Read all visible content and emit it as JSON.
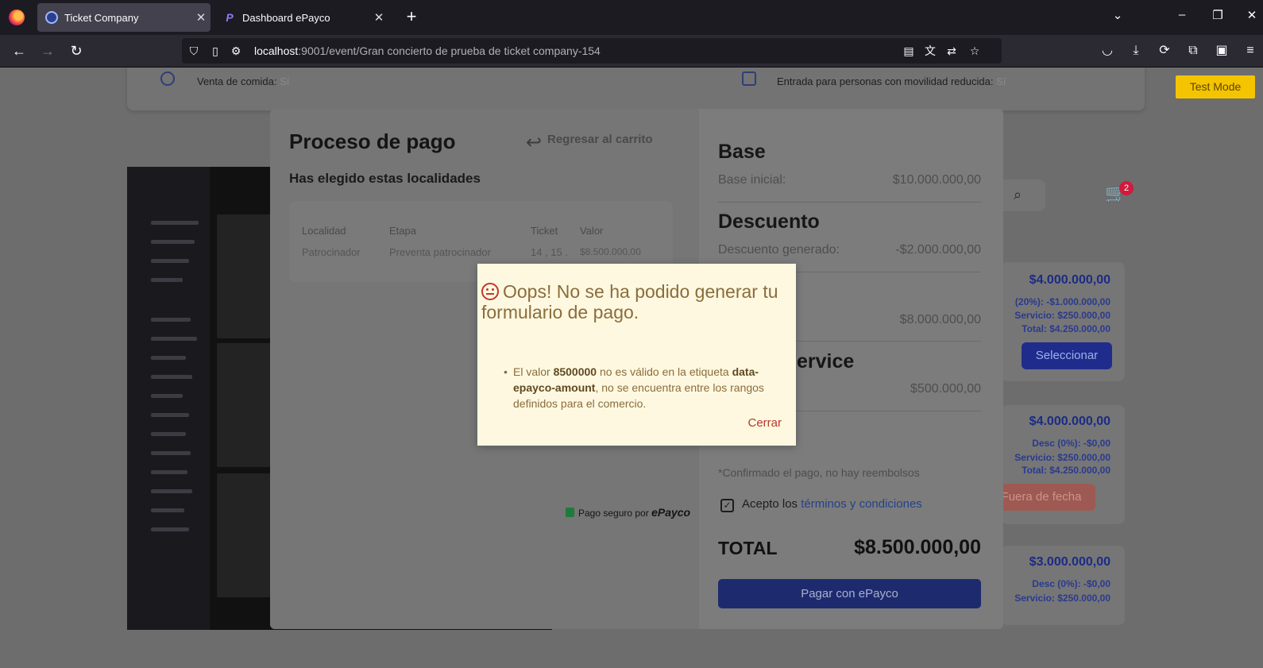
{
  "browser": {
    "tabs": [
      {
        "title": "Ticket Company",
        "active": true
      },
      {
        "title": "Dashboard ePayco",
        "active": false
      }
    ],
    "url_host": "localhost",
    "url_rest": ":9001/event/Gran concierto de prueba de ticket company-154"
  },
  "event_info": {
    "food_label": "Venta de comida:",
    "food_value": "Sí",
    "access_label": "Entrada para personas con movilidad reducida:",
    "access_value": "Sí"
  },
  "test_mode": "Test Mode",
  "cart_count": "2",
  "ticket_options": [
    {
      "price": "$4.000.000,00",
      "discount": "(20%): -$1.000.000,00",
      "service": "Servicio: $250.000,00",
      "total": "Total: $4.250.000,00",
      "button": "Seleccionar",
      "button_color": "#1f2c8c"
    },
    {
      "price": "$4.000.000,00",
      "discount": "Desc (0%): -$0,00",
      "service": "Servicio: $250.000,00",
      "total": "Total: $4.250.000,00",
      "button": "Fuera de fecha",
      "button_color": "#9e5a52"
    },
    {
      "price": "$3.000.000,00",
      "discount": "Desc (0%): -$0,00",
      "service": "Servicio: $250.000,00"
    }
  ],
  "checkout": {
    "title": "Proceso de pago",
    "back_label": "Regresar al carrito",
    "subtitle": "Has elegido estas localidades",
    "table": {
      "headers": [
        "Localidad",
        "Etapa",
        "Ticket",
        "Valor"
      ],
      "rows": [
        [
          "Patrocinador",
          "Preventa patrocinador",
          "14 , 15 .",
          "$8.500.000,00"
        ]
      ]
    },
    "secure_text": "Pago seguro por",
    "secure_brand": "ePayco",
    "summary": {
      "base_heading": "Base",
      "base_label": "Base inicial:",
      "base_value": "$10.000.000,00",
      "discount_heading": "Descuento",
      "discount_label": "Descuento generado:",
      "discount_value": "-$2.000.000,00",
      "subtotal_value": "$8.000.000,00",
      "service_heading_fragment": "ervice",
      "service_value": "$500.000,00",
      "note": "*Confirmado el pago, no hay reembolsos",
      "terms_prefix": "Acepto los",
      "terms_link": "términos y condiciones",
      "total_label": "TOTAL",
      "total_value": "$8.500.000,00",
      "pay_button": "Pagar con ePayco"
    }
  },
  "dialog": {
    "title": "Oops! No se ha podido generar tu formulario de pago.",
    "msg_1": "El valor ",
    "msg_bold_1": "8500000",
    "msg_2": " no es válido en la etiqueta ",
    "msg_bold_2": "data-epayco-amount",
    "msg_3": ", no se encuentra entre los rangos definidos para el comercio.",
    "close_label": "Cerrar"
  }
}
